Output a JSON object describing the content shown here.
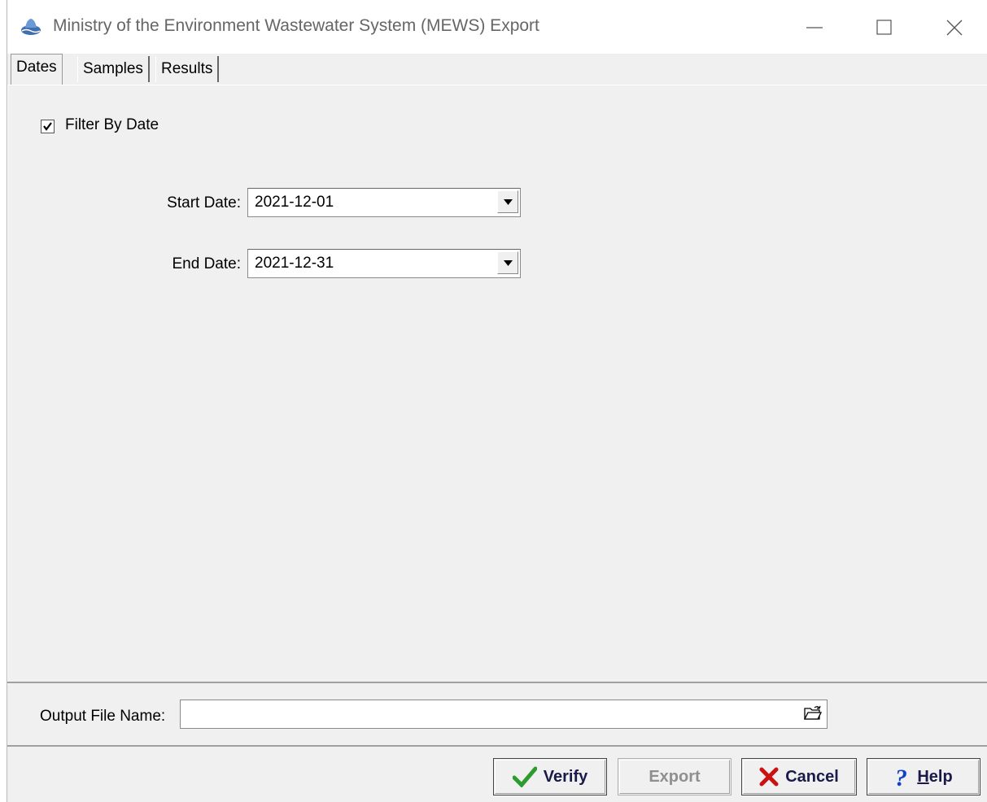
{
  "window": {
    "title": "Ministry of the Environment Wastewater System (MEWS) Export"
  },
  "tabs": [
    {
      "label": "Dates",
      "active": true
    },
    {
      "label": "Samples",
      "active": false
    },
    {
      "label": "Results",
      "active": false
    }
  ],
  "dates_tab": {
    "filter_checkbox": {
      "label": "Filter By Date",
      "checked": true
    },
    "start_date": {
      "label": "Start Date:",
      "value": "2021-12-01"
    },
    "end_date": {
      "label": "End Date:",
      "value": "2021-12-31"
    }
  },
  "output": {
    "label": "Output File Name:",
    "value": ""
  },
  "buttons": {
    "verify": "Verify",
    "export": "Export",
    "cancel": "Cancel",
    "help_prefix": "H",
    "help_rest": "elp"
  },
  "colors": {
    "verify_check": "#2e9b2e",
    "cancel_x": "#cc1111",
    "help_q": "#1540c8"
  }
}
